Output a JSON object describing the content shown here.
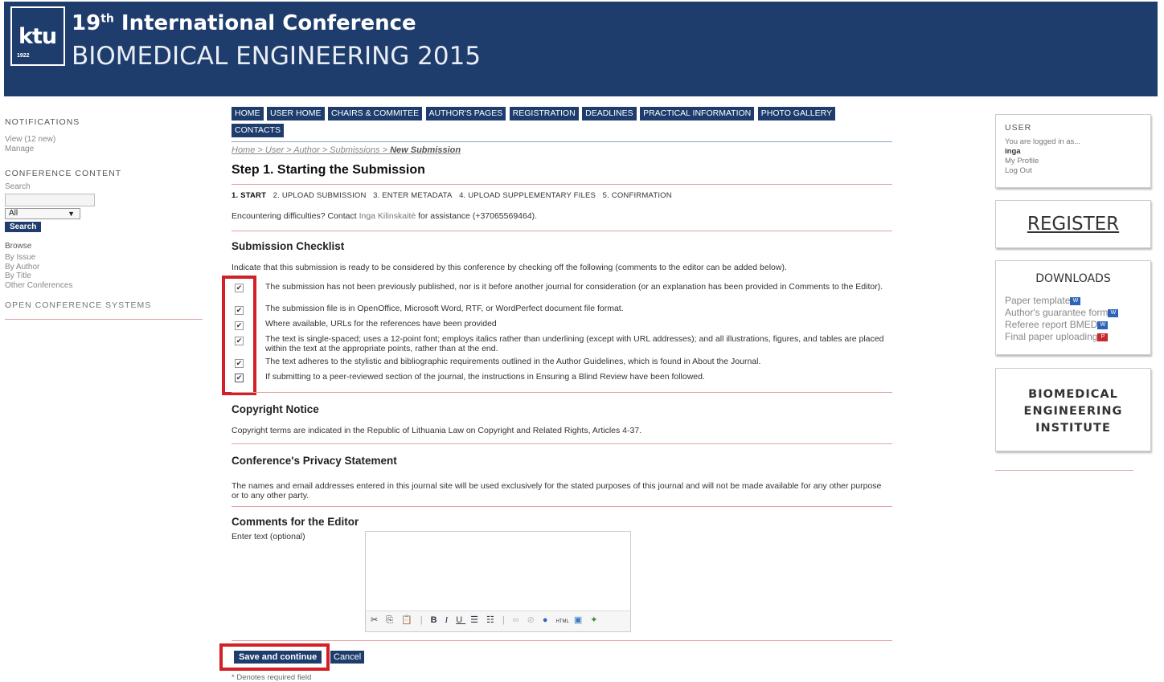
{
  "header": {
    "logo_text": "ktu",
    "logo_year": "1922",
    "title_num": "19",
    "title_sup": "th",
    "title_rest": " International Conference",
    "subtitle": "BIOMEDICAL ENGINEERING 2015"
  },
  "left_sidebar": {
    "notifications_title": "NOTIFICATIONS",
    "view_link": "View (12 new)",
    "manage_link": "Manage",
    "content_title": "CONFERENCE CONTENT",
    "search_label": "Search",
    "search_scope": "All",
    "search_button": "Search",
    "browse_label": "Browse",
    "browse_items": [
      "By Issue",
      "By Author",
      "By Title",
      "Other Conferences"
    ],
    "ocs_title": "OPEN CONFERENCE SYSTEMS"
  },
  "nav": {
    "items": [
      "HOME",
      "USER HOME",
      "CHAIRS & COMMITEE",
      "AUTHOR'S PAGES",
      "REGISTRATION",
      "DEADLINES",
      "PRACTICAL INFORMATION",
      "PHOTO GALLERY",
      "CONTACTS"
    ]
  },
  "breadcrumb": {
    "path": "Home > User > Author > Submissions > ",
    "current": "New Submission"
  },
  "page": {
    "title": "Step 1. Starting the Submission",
    "steps": [
      "1. START",
      "2. UPLOAD SUBMISSION",
      "3. ENTER METADATA",
      "4. UPLOAD SUPPLEMENTARY FILES",
      "5. CONFIRMATION"
    ],
    "contact_pre": "Encountering difficulties? Contact ",
    "contact_name": "Inga Kilinskaitė",
    "contact_post": " for assistance (+37065569464)."
  },
  "checklist": {
    "title": "Submission Checklist",
    "intro": "Indicate that this submission is ready to be considered by this conference by checking off the following (comments to the editor can be added below).",
    "items": [
      "The submission has not been previously published, nor is it before another journal for consideration (or an explanation has been provided in Comments to the Editor).",
      "The submission file is in OpenOffice, Microsoft Word, RTF, or WordPerfect document file format.",
      "Where available, URLs for the references have been provided",
      "The text is single-spaced; uses a 12-point font; employs italics rather than underlining (except with URL addresses); and all illustrations, figures, and tables are placed within the text at the appropriate points, rather than at the end.",
      "The text adheres to the stylistic and bibliographic requirements outlined in the Author Guidelines, which is found in About the Journal.",
      "If submitting to a peer-reviewed section of the journal, the instructions in Ensuring a Blind Review have been followed."
    ]
  },
  "copyright": {
    "title": "Copyright Notice",
    "text": "Copyright terms are indicated in the Republic of Lithuania Law on Copyright and Related Rights, Articles 4-37."
  },
  "privacy": {
    "title": "Conference's Privacy Statement",
    "text": "The names and email addresses entered in this journal site will be used exclusively for the stated purposes of this journal and will not be made available for any other purpose or to any other party."
  },
  "comments": {
    "title": "Comments for the Editor",
    "label": "Enter text (optional)"
  },
  "actions": {
    "save": "Save and continue",
    "cancel": "Cancel",
    "required_note": "* Denotes required field"
  },
  "right_sidebar": {
    "user_title": "USER",
    "logged_in_as": "You are logged in as...",
    "username": "inga",
    "my_profile": "My Profile",
    "log_out": "Log Out",
    "register": "REGISTER",
    "downloads_title": "DOWNLOADS",
    "downloads": [
      "Paper template",
      "Author's guarantee form",
      "Referee report BMED",
      "Final paper uploading"
    ],
    "institute_lines": [
      "BIOMEDICAL",
      "ENGINEERING",
      "INSTITUTE"
    ]
  },
  "colors": {
    "brand": "#1e3d6d",
    "highlight": "#d41f26",
    "divider": "#e4a1a1"
  }
}
